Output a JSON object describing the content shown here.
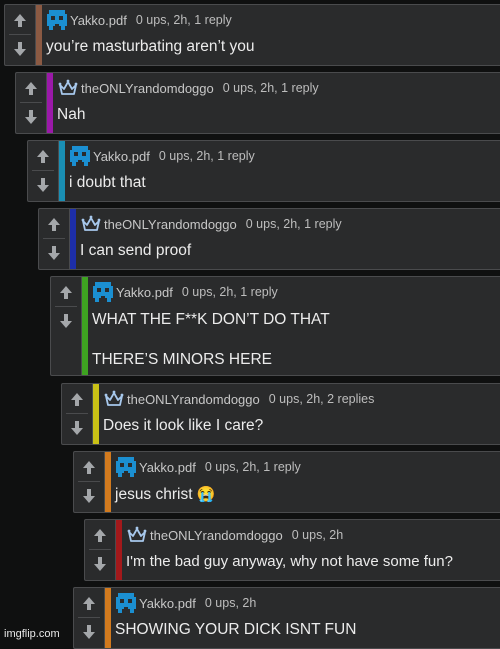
{
  "comments": [
    {
      "user": "Yakko.pdf",
      "stats": "0 ups, 2h, 1 reply",
      "text": "you’re masturbating aren’t you",
      "avatar": "pixel-avatar",
      "stripe": "#8b5a43"
    },
    {
      "user": "theONLYrandomdoggo",
      "stats": "0 ups, 2h, 1 reply",
      "text": "Nah",
      "avatar": "crown-avatar",
      "stripe": "#9b19a9"
    },
    {
      "user": "Yakko.pdf",
      "stats": "0 ups, 2h, 1 reply",
      "text": "i doubt that",
      "avatar": "pixel-avatar",
      "stripe": "#1a8fb4"
    },
    {
      "user": "theONLYrandomdoggo",
      "stats": "0 ups, 2h, 1 reply",
      "text": "I can send proof",
      "avatar": "crown-avatar",
      "stripe": "#1d2ea8"
    },
    {
      "user": "Yakko.pdf",
      "stats": "0 ups, 2h, 1 reply",
      "text_lines": [
        "WHAT THE F**K DON’T DO THAT",
        "THERE’S MINORS HERE"
      ],
      "avatar": "pixel-avatar",
      "stripe": "#3ea321"
    },
    {
      "user": "theONLYrandomdoggo",
      "stats": "0 ups, 2h, 2 replies",
      "text": "Does it look like I care?",
      "avatar": "crown-avatar",
      "stripe": "#c9c116"
    },
    {
      "user": "Yakko.pdf",
      "stats": "0 ups, 2h, 1 reply",
      "text": "jesus christ",
      "emoji": "😭",
      "avatar": "pixel-avatar",
      "stripe": "#d27a1e"
    },
    {
      "user": "theONLYrandomdoggo",
      "stats": "0 ups, 2h",
      "text": "I'm the bad guy anyway, why not have some fun?",
      "avatar": "crown-avatar",
      "stripe": "#a3191b"
    },
    {
      "user": "Yakko.pdf",
      "stats": "0 ups, 2h",
      "text": "SHOWING YOUR DICK ISNT FUN",
      "avatar": "pixel-avatar",
      "stripe": "#d27a1e"
    }
  ],
  "watermark": "imgflip.com",
  "colors": {
    "background": "#0f1010",
    "panel": "#2a2b2c",
    "border": "#4a4b4d",
    "text": "#ececec",
    "pixel_avatar": "#1b8fd1"
  }
}
